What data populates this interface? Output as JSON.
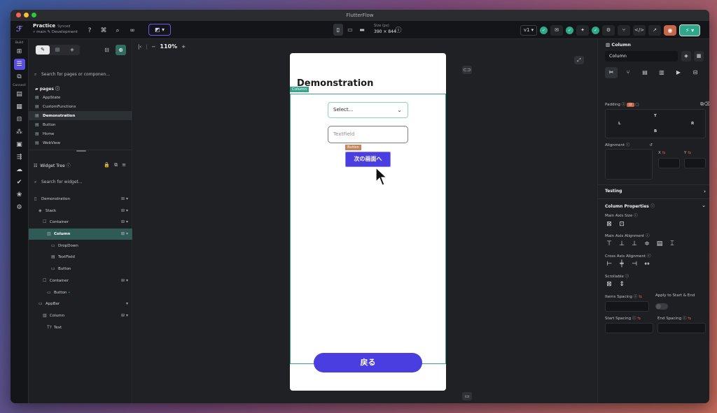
{
  "window": {
    "title": "FlutterFlow"
  },
  "project": {
    "name": "Practice",
    "sync_status": "Synced",
    "branch": "main",
    "environment": "Development"
  },
  "canvas_info": {
    "size_label": "Size (px)",
    "size_value": "390 × 844",
    "zoom": "110%"
  },
  "toolbar": {
    "version": "v1"
  },
  "rail": {
    "build_label": "Build",
    "connect_label": "Connect"
  },
  "left": {
    "search_pages_placeholder": "Search for pages or componen...",
    "pages_header": "pages",
    "pages": [
      "AppState",
      "CustomFunctions",
      "Demonstration",
      "Button",
      "Home",
      "WebView"
    ],
    "active_page": "Demonstration",
    "widget_tree_title": "Widget Tree",
    "search_widgets_placeholder": "Search for widget...",
    "tree": [
      "Demonstration",
      "Stack",
      "Container",
      "Column",
      "DropDown",
      "TextField",
      "Button",
      "Container",
      "Button",
      "AppBar",
      "Column",
      "Text"
    ]
  },
  "phone": {
    "title": "Demonstration",
    "column_tag": "Column",
    "dropdown_value": "Select...",
    "textfield_placeholder": "TextField",
    "button_tag": "Button",
    "next_button_label": "次の画面へ",
    "back_button_label": "戻る"
  },
  "right": {
    "widget_type": "Column",
    "widget_name": "Column",
    "padding_label": "Padding",
    "pad_t": "T",
    "pad_l": "L",
    "pad_r": "R",
    "pad_b": "B",
    "alignment_label": "Alignment",
    "x_label": "X",
    "y_label": "Y",
    "testing_label": "Testing",
    "column_props_label": "Column Properties",
    "main_axis_size": "Main Axis Size",
    "main_axis_alignment": "Main Axis Alignment",
    "cross_axis_alignment": "Cross Axis Alignment",
    "scrollable": "Scrollable",
    "items_spacing": "Items Spacing",
    "apply_start_end": "Apply to Start & End",
    "start_spacing": "Start Spacing",
    "end_spacing": "End Spacing"
  },
  "colors": {
    "accent": "#4a3ee0",
    "column_outline": "#39a38c",
    "button_tag": "#c8825a",
    "run_green": "#2fa889"
  }
}
